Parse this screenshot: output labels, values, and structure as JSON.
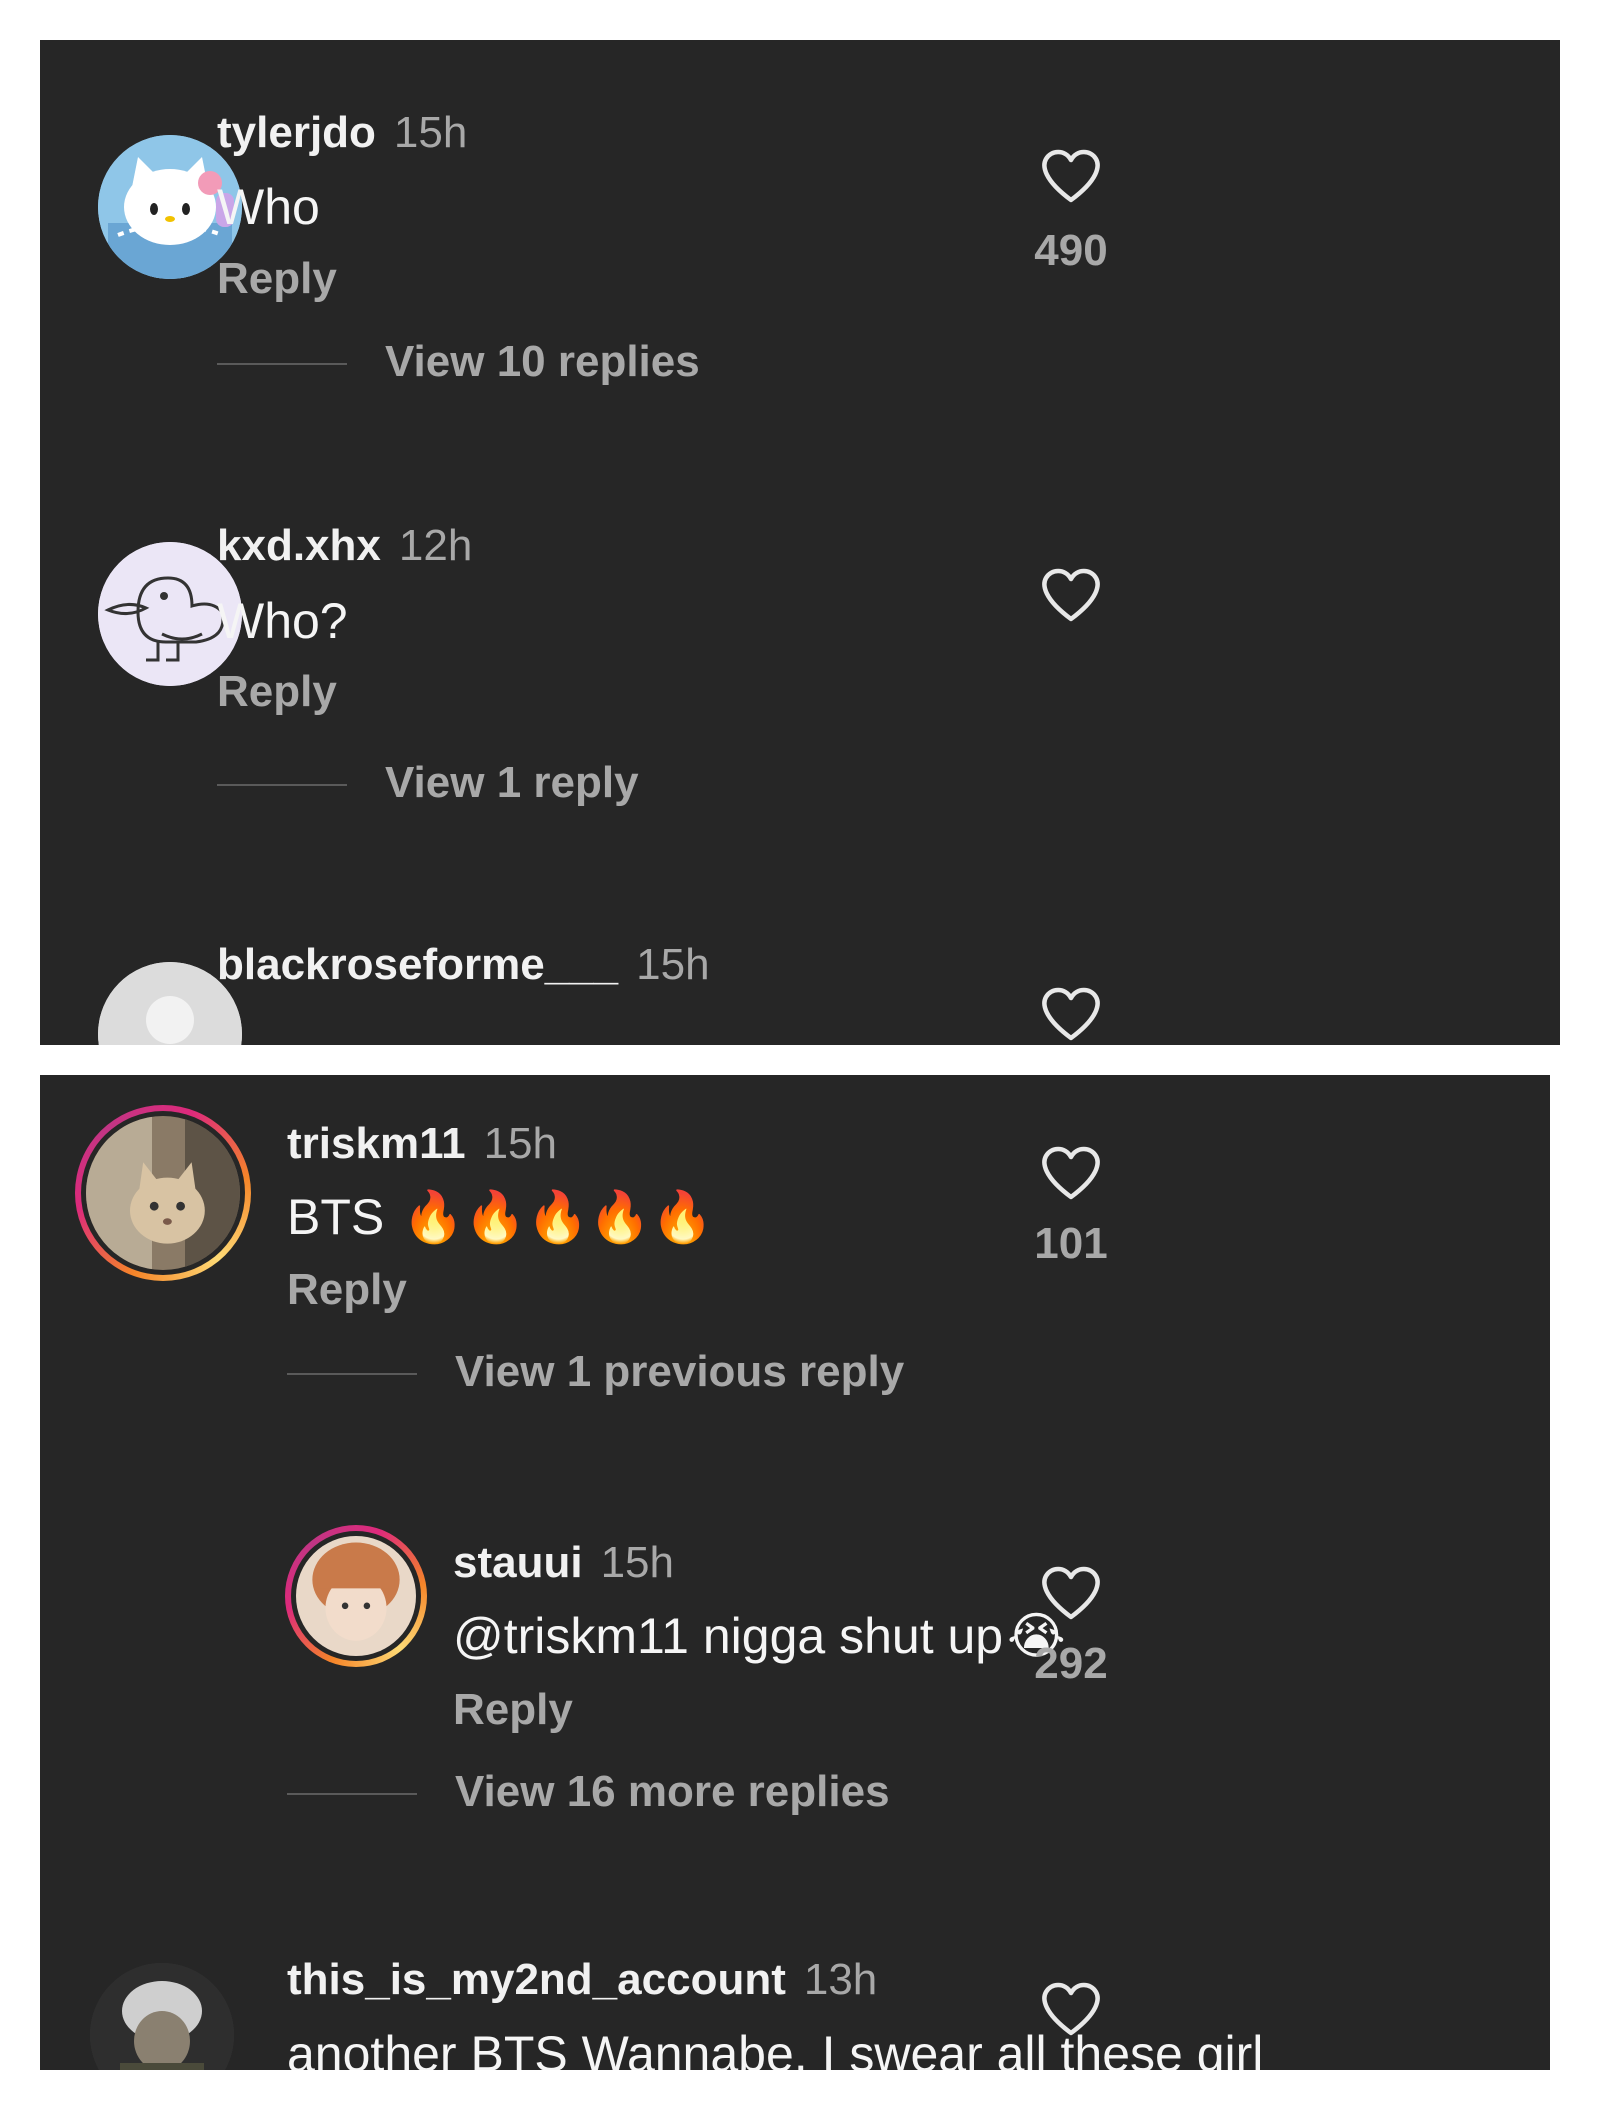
{
  "panel_top": {
    "comments": [
      {
        "username": "tylerjdo",
        "time": "15h",
        "text": "Who",
        "reply_label": "Reply",
        "likes": "490",
        "view_replies": "View 10 replies",
        "avatar_icon": "hello-kitty-avatar"
      },
      {
        "username": "kxd.xhx",
        "time": "12h",
        "text": "Who?",
        "reply_label": "Reply",
        "likes": "",
        "view_replies": "View 1 reply",
        "avatar_icon": "duck-drawing-avatar"
      },
      {
        "username": "blackroseforme___",
        "time": "15h",
        "avatar_icon": "default-avatar"
      }
    ]
  },
  "panel_bottom": {
    "main": {
      "username": "triskm11",
      "time": "15h",
      "text": "BTS",
      "emojis": "🔥🔥🔥🔥🔥",
      "reply_label": "Reply",
      "likes": "101",
      "view_replies": "View 1 previous reply",
      "avatar_icon": "cat-photo-avatar"
    },
    "reply": {
      "username": "stauui",
      "time": "15h",
      "text": "@triskm11 nigga shut up",
      "emoji": "😭",
      "reply_label": "Reply",
      "likes": "292",
      "view_replies": "View 16 more replies",
      "avatar_icon": "person-photo-avatar"
    },
    "next": {
      "username": "this_is_my2nd_account",
      "time": "13h",
      "text": "another BTS Wannabe, I swear all these girl",
      "avatar_icon": "dark-character-avatar"
    }
  },
  "colors": {
    "background": "#262626",
    "text": "#f5f5f5",
    "muted": "#a8a8a8",
    "story_ring": "#dd2a7b"
  }
}
